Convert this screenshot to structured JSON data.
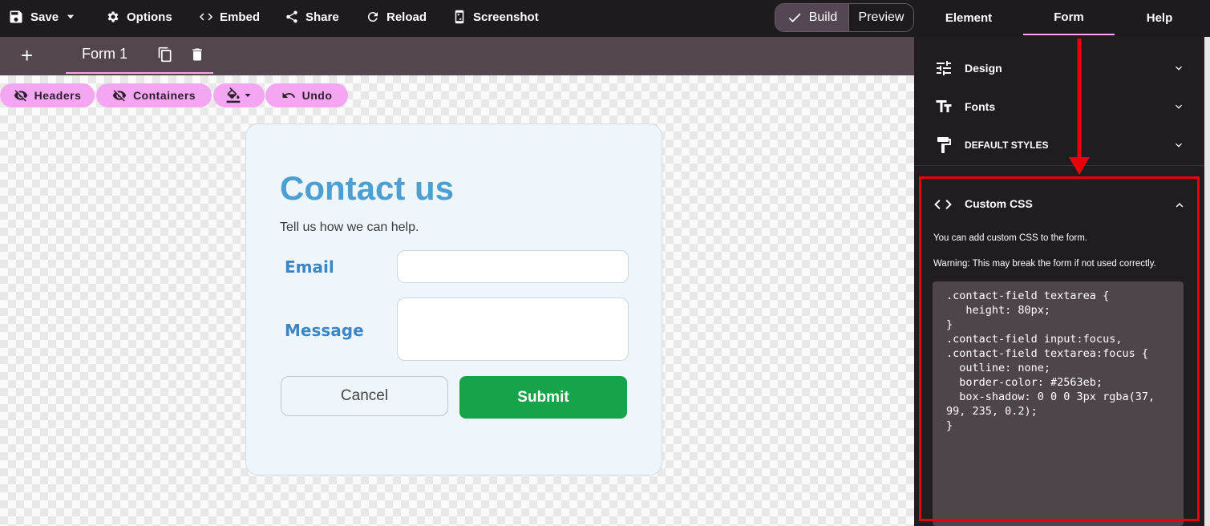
{
  "toolbar": {
    "save": "Save",
    "options": "Options",
    "embed": "Embed",
    "share": "Share",
    "reload": "Reload",
    "screenshot": "Screenshot"
  },
  "mode": {
    "build": "Build",
    "preview": "Preview",
    "active": "Build"
  },
  "right_tabs": [
    {
      "label": "Element",
      "active": false
    },
    {
      "label": "Form",
      "active": true
    },
    {
      "label": "Help",
      "active": false
    }
  ],
  "form_tabs": {
    "add": "+",
    "current": "Form 1"
  },
  "canvas_toolbar": {
    "headers": "Headers",
    "containers": "Containers",
    "undo": "Undo"
  },
  "form": {
    "title": "Contact us",
    "subtitle": "Tell us how we can help.",
    "email_label": "Email",
    "email_value": "",
    "message_label": "Message",
    "message_value": "",
    "cancel": "Cancel",
    "submit": "Submit"
  },
  "panel": {
    "design": "Design",
    "fonts": "Fonts",
    "default_styles": "DEFAULT STYLES",
    "custom_css_title": "Custom CSS",
    "custom_css_info": "You can add custom CSS to the form.",
    "custom_css_warning": "Warning: This may break the form if not used correctly.",
    "custom_css_code": ".contact-field textarea {\n   height: 80px;\n}\n.contact-field input:focus,\n.contact-field textarea:focus {\n  outline: none;\n  border-color: #2563eb;\n  box-shadow: 0 0 0 3px rgba(37,\n99, 235, 0.2);\n}"
  },
  "colors": {
    "accent_pink": "#f5a6f2",
    "title_blue": "#4b9fd1",
    "submit_green": "#16a34a",
    "highlight_red": "#e8000b"
  }
}
